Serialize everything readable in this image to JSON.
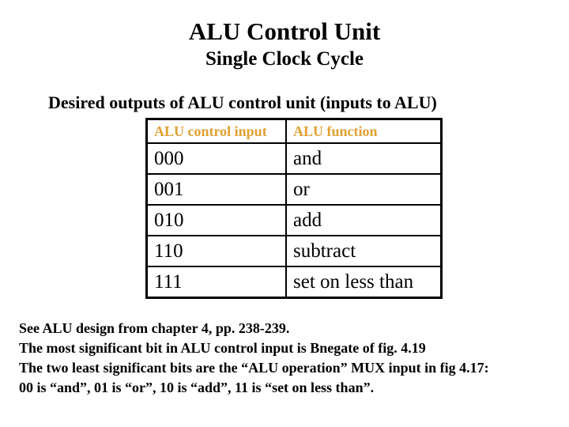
{
  "slide": {
    "title": "ALU Control Unit",
    "subtitle": "Single Clock Cycle",
    "description": "Desired outputs of ALU control unit (inputs to ALU)"
  },
  "table": {
    "header_color": "#e0a030",
    "headers": [
      "ALU control input",
      "ALU function"
    ],
    "rows": [
      {
        "input": "000",
        "function": "and"
      },
      {
        "input": "001",
        "function": "or"
      },
      {
        "input": "010",
        "function": "add"
      },
      {
        "input": "110",
        "function": "subtract"
      },
      {
        "input": "111",
        "function": "set on less than"
      }
    ]
  },
  "notes": [
    "See ALU design from chapter 4, pp. 238-239.",
    "The most significant bit in ALU control input is Bnegate of fig. 4.19",
    "The two least significant bits are the “ALU operation” MUX input in fig 4.17:",
    "00 is “and”, 01 is “or”, 10 is “add”, 11 is “set on less than”."
  ]
}
